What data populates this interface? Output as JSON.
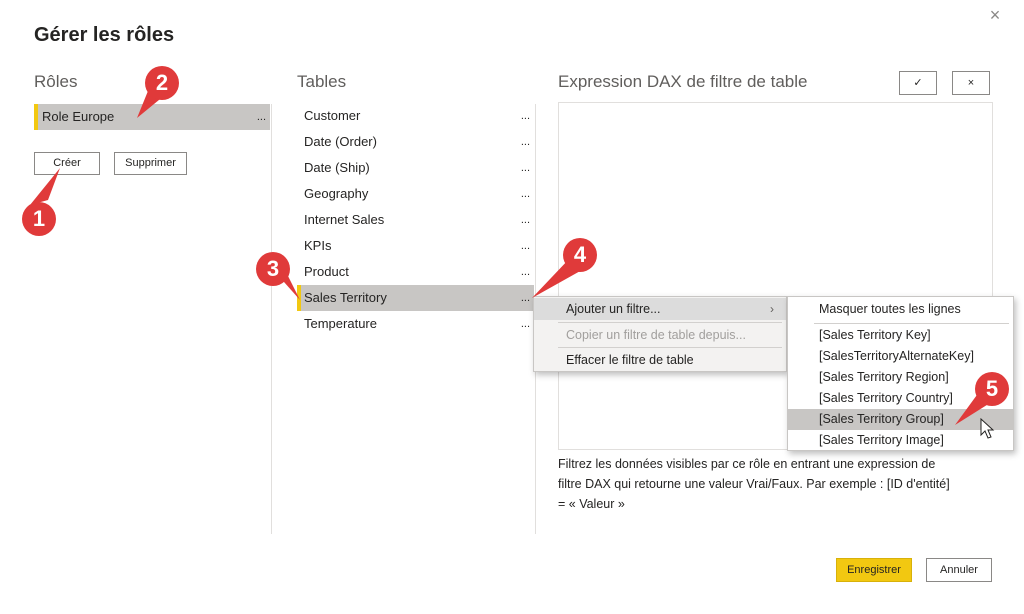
{
  "dialog": {
    "title": "Gérer les rôles",
    "close_glyph": "×"
  },
  "roles": {
    "heading": "Rôles",
    "items": [
      {
        "label": "Role Europe",
        "selected": true,
        "more": "..."
      }
    ],
    "create_label": "Créer",
    "delete_label": "Supprimer"
  },
  "tables": {
    "heading": "Tables",
    "items": [
      {
        "label": "Customer",
        "more": "..."
      },
      {
        "label": "Date (Order)",
        "more": "..."
      },
      {
        "label": "Date (Ship)",
        "more": "..."
      },
      {
        "label": "Geography",
        "more": "..."
      },
      {
        "label": "Internet Sales",
        "more": "..."
      },
      {
        "label": "KPIs",
        "more": "..."
      },
      {
        "label": "Product",
        "more": "..."
      },
      {
        "label": "Sales Territory",
        "more": "...",
        "selected": true
      },
      {
        "label": "Temperature",
        "more": "..."
      }
    ]
  },
  "dax": {
    "heading": "Expression DAX de filtre de table",
    "confirm_glyph": "✓",
    "discard_glyph": "×",
    "help_text": "Filtrez les données visibles par ce rôle en entrant une expression de filtre DAX qui retourne une valeur Vrai/Faux. Par exemple : [ID d'entité] = « Valeur »"
  },
  "context_menu": {
    "items": [
      {
        "label": "Ajouter un filtre...",
        "has_submenu": true,
        "submenu_glyph": "›"
      },
      {
        "label": "Copier un filtre de table depuis...",
        "disabled": true
      },
      {
        "label": "Effacer le filtre de table"
      }
    ]
  },
  "submenu": {
    "items": [
      {
        "label": "Masquer toutes les lignes"
      },
      {
        "label": "[Sales Territory Key]"
      },
      {
        "label": "[SalesTerritoryAlternateKey]"
      },
      {
        "label": "[Sales Territory Region]"
      },
      {
        "label": "[Sales Territory Country]"
      },
      {
        "label": "[Sales Territory Group]",
        "highlighted": true
      },
      {
        "label": "[Sales Territory Image]"
      }
    ]
  },
  "footer": {
    "save_label": "Enregistrer",
    "cancel_label": "Annuler"
  },
  "callouts": [
    "1",
    "2",
    "3",
    "4",
    "5"
  ],
  "colors": {
    "accent": "#f2c811",
    "callout": "#e03a3a",
    "selection": "#c8c6c4"
  }
}
